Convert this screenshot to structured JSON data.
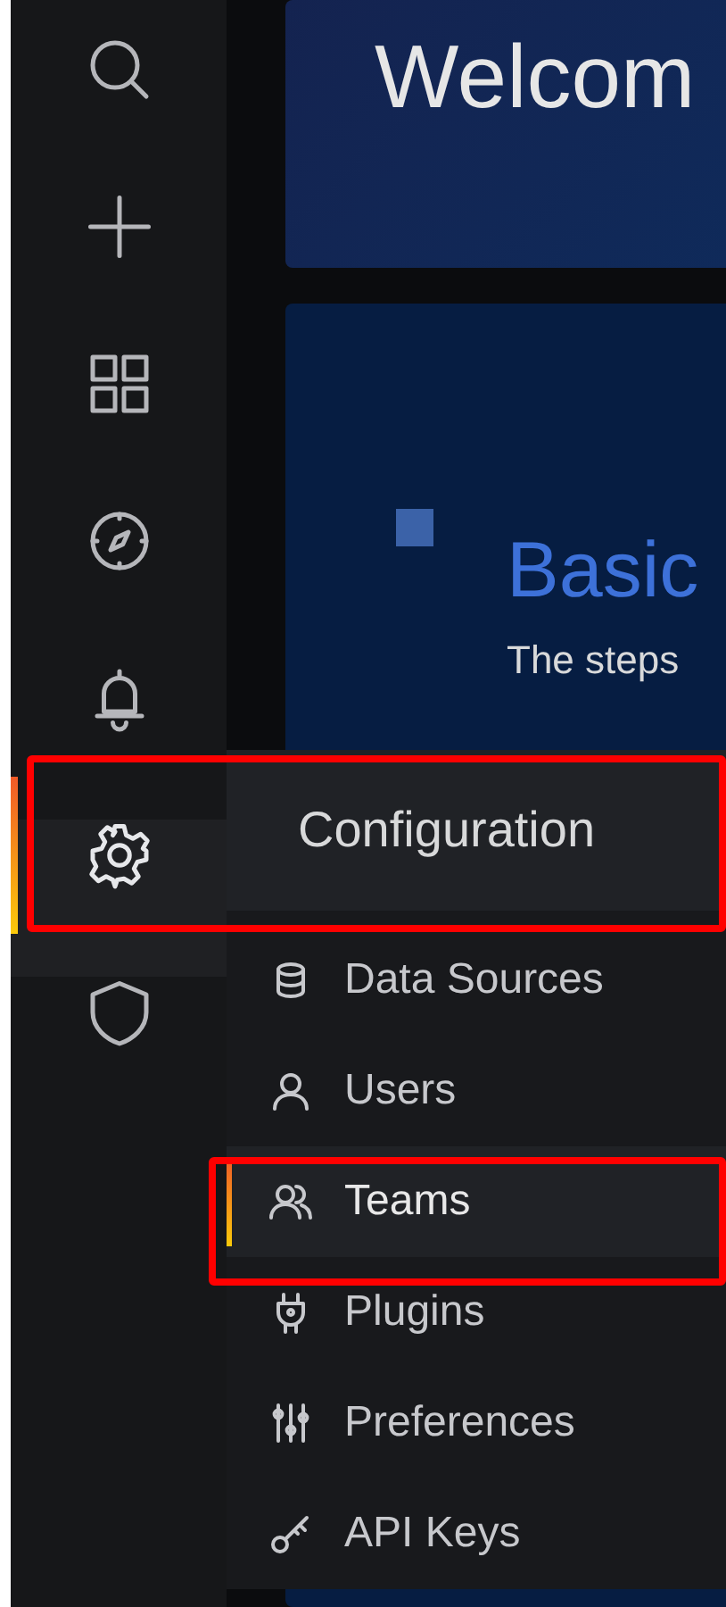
{
  "sidebar": {
    "items": [
      {
        "selected": false
      },
      {
        "selected": false
      },
      {
        "selected": false
      },
      {
        "selected": false
      },
      {
        "selected": false
      },
      {
        "selected": true
      },
      {
        "selected": false
      }
    ]
  },
  "welcome_panel": {
    "title": "Welcom"
  },
  "basic_panel": {
    "title": "Basic",
    "text": "The steps"
  },
  "config_menu": {
    "title": "Configuration",
    "items": [
      {
        "label": "Data Sources",
        "selected": false
      },
      {
        "label": "Users",
        "selected": false
      },
      {
        "label": "Teams",
        "selected": true
      },
      {
        "label": "Plugins",
        "selected": false
      },
      {
        "label": "Preferences",
        "selected": false
      },
      {
        "label": "API Keys",
        "selected": false
      }
    ]
  }
}
